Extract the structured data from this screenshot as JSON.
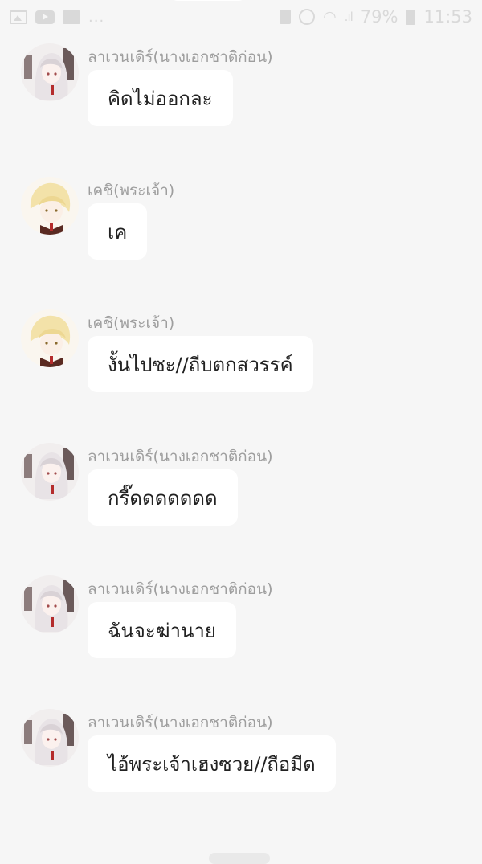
{
  "status_bar": {
    "battery": "79%",
    "time": "11:53",
    "overflow": "..."
  },
  "messages": [
    {
      "sender": "ลาเวนเดิร์(นางเอกชาติก่อน)",
      "text": "คิดไม่ออกละ",
      "avatar": "girl-silver-hair"
    },
    {
      "sender": "เคชิ(พระเจ้า)",
      "text": "เค",
      "avatar": "boy-blonde-hair"
    },
    {
      "sender": "เคชิ(พระเจ้า)",
      "text": "งั้นไปซะ//ถีบตกสวรรค์",
      "avatar": "boy-blonde-hair"
    },
    {
      "sender": "ลาเวนเดิร์(นางเอกชาติก่อน)",
      "text": "กรี๊ดดดดดดด",
      "avatar": "girl-silver-hair"
    },
    {
      "sender": "ลาเวนเดิร์(นางเอกชาติก่อน)",
      "text": "ฉันจะฆ่านาย",
      "avatar": "girl-silver-hair"
    },
    {
      "sender": "ลาเวนเดิร์(นางเอกชาติก่อน)",
      "text": "ไอ้พระเจ้าเฮงซวย//ถือมีด",
      "avatar": "girl-silver-hair"
    }
  ]
}
